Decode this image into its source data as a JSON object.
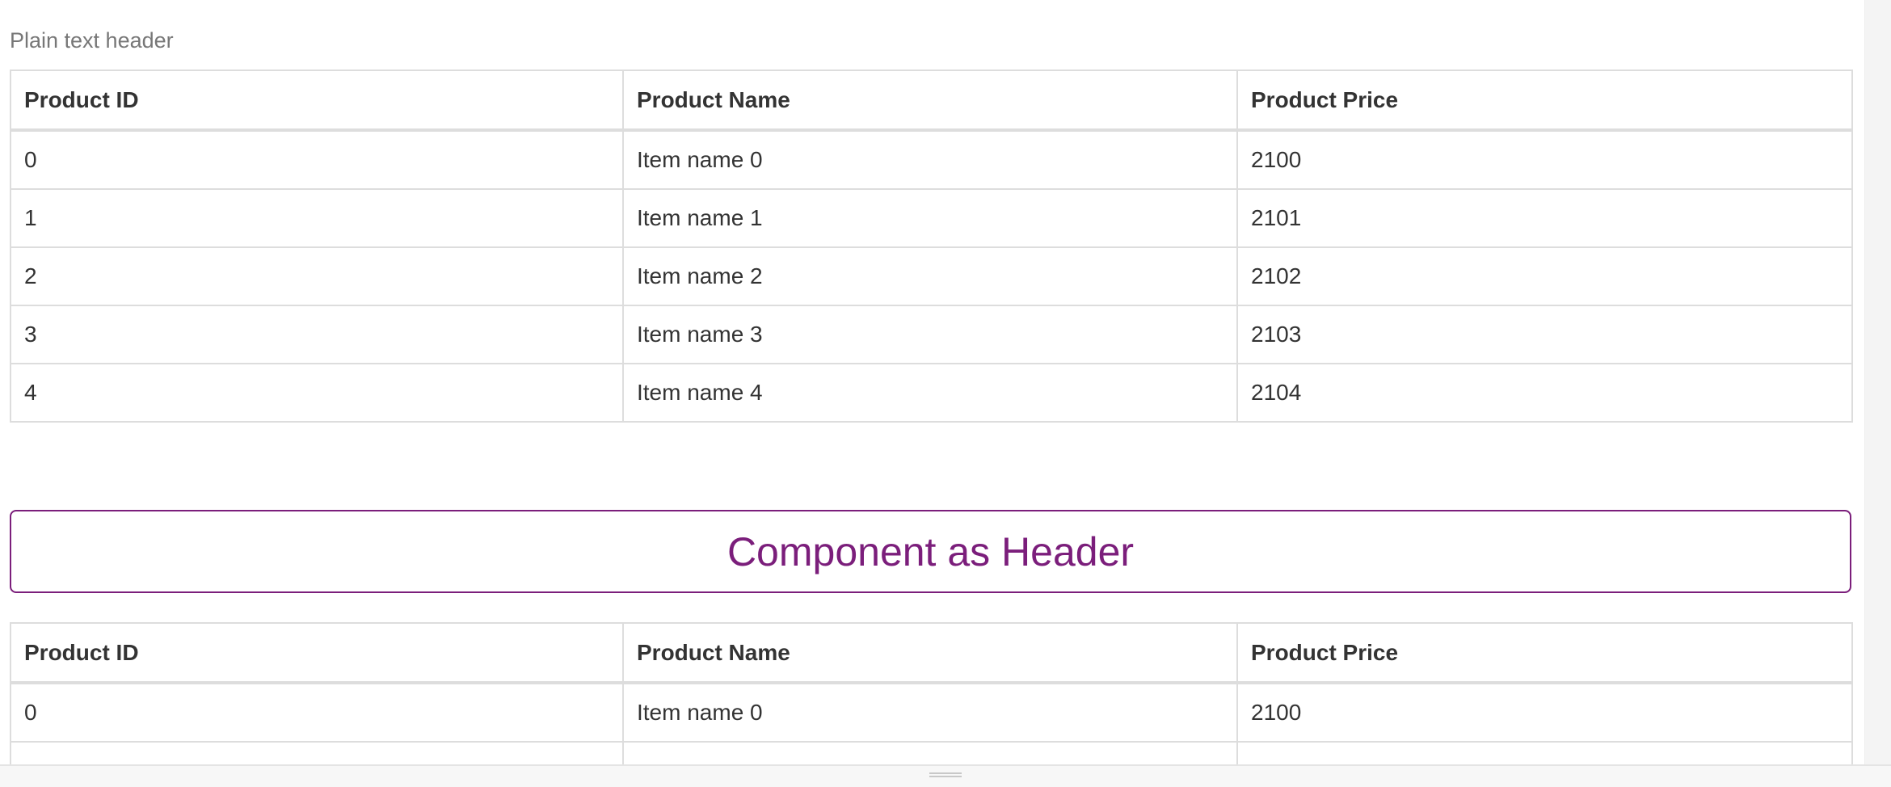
{
  "plain_header": {
    "label": "Plain text header"
  },
  "columns": [
    "Product ID",
    "Product Name",
    "Product Price"
  ],
  "table_top": {
    "rows": [
      [
        "0",
        "Item name 0",
        "2100"
      ],
      [
        "1",
        "Item name 1",
        "2101"
      ],
      [
        "2",
        "Item name 2",
        "2102"
      ],
      [
        "3",
        "Item name 3",
        "2103"
      ],
      [
        "4",
        "Item name 4",
        "2104"
      ]
    ]
  },
  "component_header": {
    "label": "Component as Header",
    "color": "#7b1e7b"
  },
  "table_bottom": {
    "rows": [
      [
        "0",
        "Item name 0",
        "2100"
      ],
      [
        "",
        "",
        ""
      ]
    ]
  }
}
